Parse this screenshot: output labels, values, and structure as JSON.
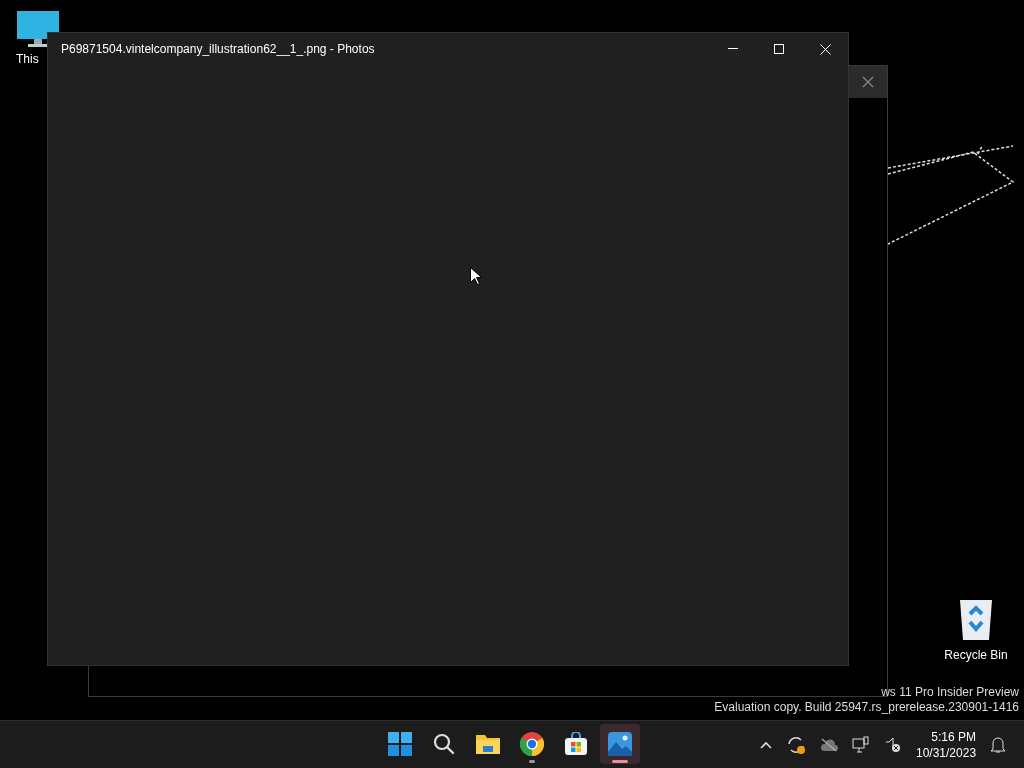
{
  "desktop_icons": [
    {
      "kind": "pc",
      "label": "This"
    },
    {
      "kind": "bin",
      "label": "Recycle Bin"
    }
  ],
  "window": {
    "title": "P69871504.vintelcompany_illustration62__1_.png - Photos"
  },
  "watermark_lines": [
    "ws 11 Pro Insider Preview",
    "Evaluation copy. Build 25947.rs_prerelease.230901-1416"
  ],
  "taskbar": {
    "apps": [
      {
        "kind": "start",
        "running": false,
        "selected": false
      },
      {
        "kind": "search",
        "running": false,
        "selected": false
      },
      {
        "kind": "files",
        "running": false,
        "selected": false
      },
      {
        "kind": "chrome",
        "running": true,
        "selected": false
      },
      {
        "kind": "store",
        "running": false,
        "selected": false
      },
      {
        "kind": "photos",
        "running": true,
        "selected": true
      }
    ],
    "tray": {
      "time": "5:16 PM",
      "date": "10/31/2023"
    }
  }
}
